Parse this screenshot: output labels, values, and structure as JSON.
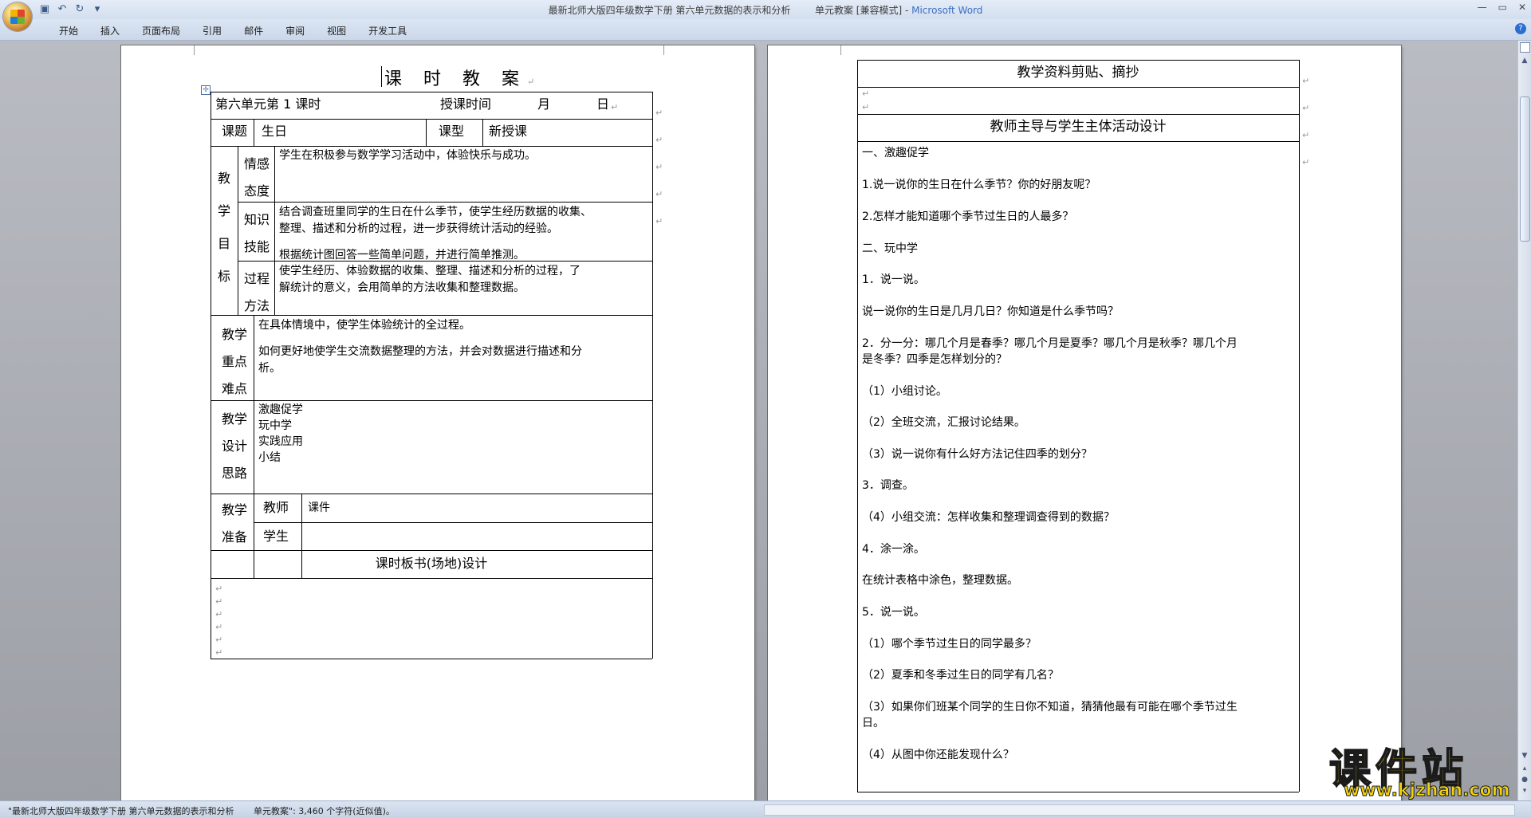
{
  "window": {
    "doc_name": "最新北师大版四年级数学下册 第六单元数据的表示和分析",
    "doc_suffix": "单元教案 [兼容模式] -",
    "app_name": "Microsoft Word"
  },
  "ribbon": {
    "tabs": [
      "开始",
      "插入",
      "页面布局",
      "引用",
      "邮件",
      "审阅",
      "视图",
      "开发工具"
    ]
  },
  "page1": {
    "title": "课 时 教 案",
    "row1": {
      "unit": "第六单元第 1 课时",
      "time_label": "授课时间",
      "month": "月",
      "day": "日"
    },
    "row2": {
      "topic_label": "课题",
      "topic": "生日",
      "type_label": "课型",
      "type": "新授课"
    },
    "goals": {
      "side_label": [
        "教",
        "学",
        "目",
        "标"
      ],
      "emotion_label": [
        "情感",
        "态度"
      ],
      "emotion": "学生在积极参与数学学习活动中，体验快乐与成功。",
      "knowledge_label": [
        "知识",
        "技能"
      ],
      "knowledge_1a": "结合调查班里同学的生日在什么季节，使学生经历数据的收集、",
      "knowledge_1b": "整理、描述和分析的过程，进一步获得统计活动的经验。",
      "knowledge_2": "根据统计图回答一些简单问题，并进行简单推测。",
      "process_label": [
        "过程",
        "方法"
      ],
      "process_a": "使学生经历、体验数据的收集、整理、描述和分析的过程，了",
      "process_b": "解统计的意义，会用简单的方法收集和整理数据。"
    },
    "focus": {
      "label": [
        "教学",
        "重点",
        "难点"
      ],
      "line1": "在具体情境中，使学生体验统计的全过程。",
      "line2a": "如何更好地使学生交流数据整理的方法，并会对数据进行描述和分",
      "line2b": "析。"
    },
    "design": {
      "label": [
        "教学",
        "设计",
        "思路"
      ],
      "items": [
        "激趣促学",
        "玩中学",
        "实践应用",
        "小结"
      ]
    },
    "prep": {
      "label": [
        "教学",
        "准备"
      ],
      "teacher_label": "教师",
      "teacher": "课件",
      "student_label": "学生",
      "student": ""
    },
    "board": {
      "title": "课时板书(场地)设计"
    }
  },
  "page2": {
    "header1": "教学资料剪贴、摘抄",
    "header2": "教师主导与学生主体活动设计",
    "lines": [
      "一、激趣促学",
      "1.说一说你的生日在什么季节？你的好朋友呢？",
      "2.怎样才能知道哪个季节过生日的人最多？",
      "二、玩中学",
      "1．说一说。",
      "说一说你的生日是几月几日？你知道是什么季节吗？",
      "2．分一分：哪几个月是春季？哪几个月是夏季？哪几个月是秋季？哪几个月",
      "是冬季？四季是怎样划分的？",
      "（1）小组讨论。",
      "（2）全班交流，汇报讨论结果。",
      "（3）说一说你有什么好方法记住四季的划分？",
      "3．调查。",
      "（4）小组交流：怎样收集和整理调查得到的数据？",
      "4．涂一涂。",
      "在统计表格中涂色，整理数据。",
      "5．说一说。",
      "（1）哪个季节过生日的同学最多？",
      "（2）夏季和冬季过生日的同学有几名？",
      "（3）如果你们班某个同学的生日你不知道，猜猜他最有可能在哪个季节过生",
      "日。",
      "（4）从图中你还能发现什么？"
    ]
  },
  "statusbar": {
    "doc": "\"最新北师大版四年级数学下册 第六单元数据的表示和分析",
    "count": "单元教案\": 3,460 个字符(近似值)。"
  },
  "watermark": {
    "main": "课件站",
    "url": "www.kjzhan.com"
  }
}
